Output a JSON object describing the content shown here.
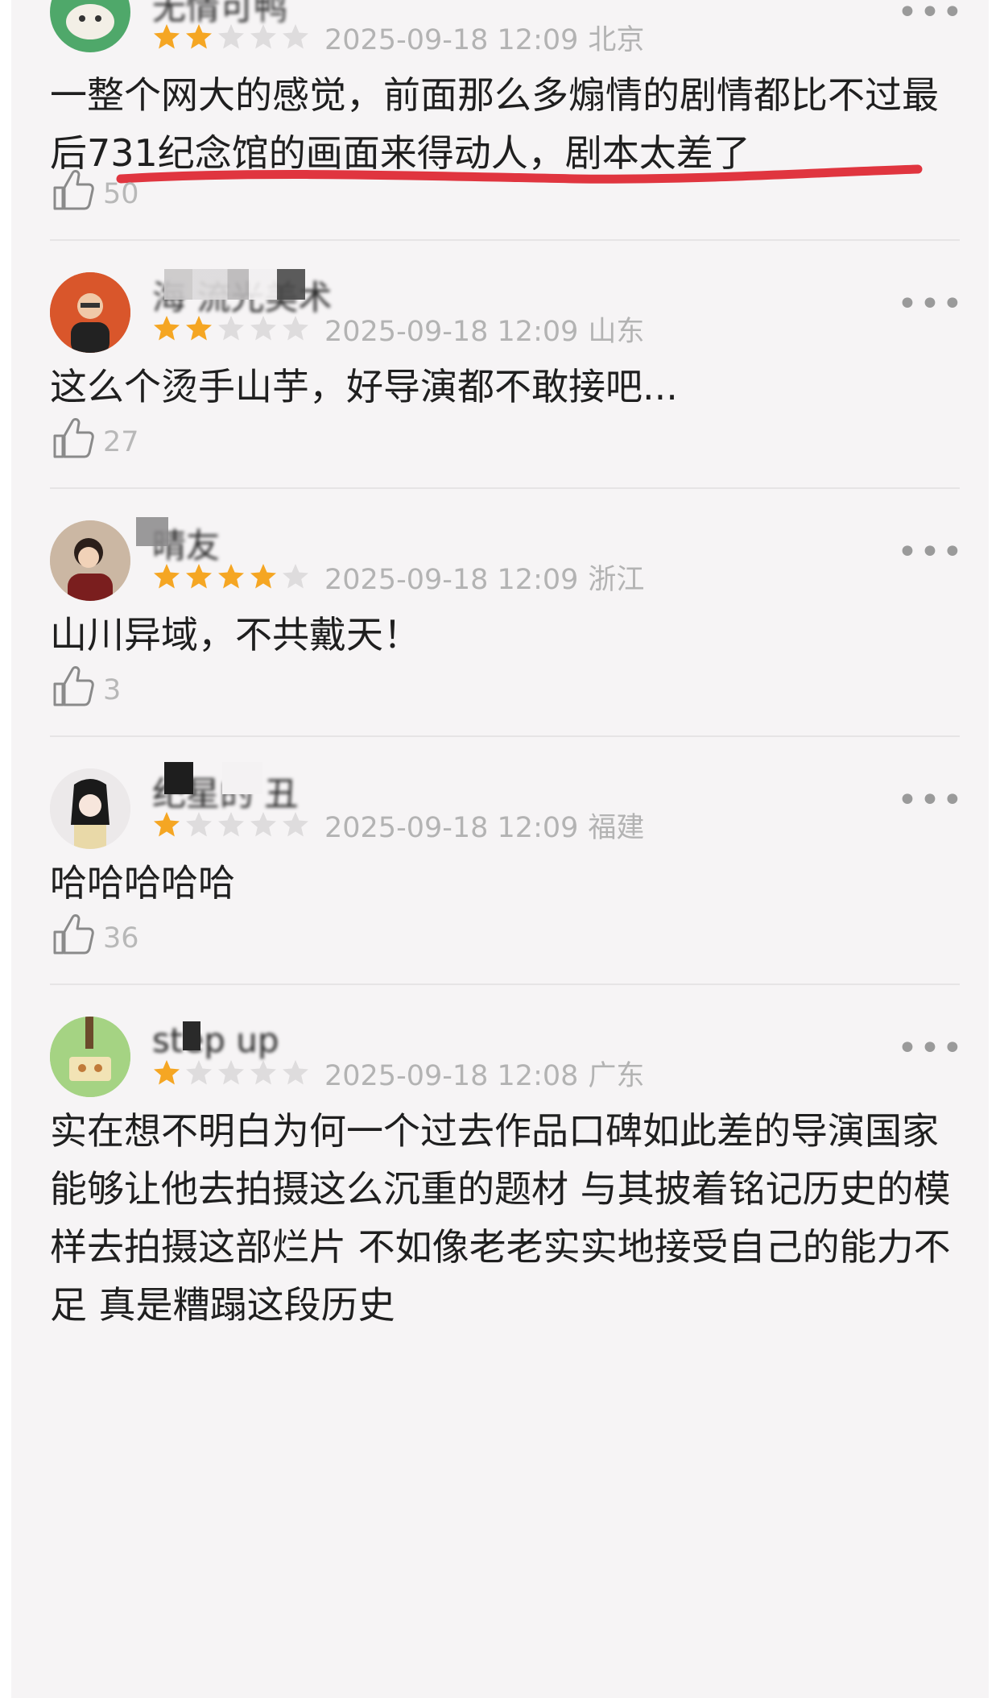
{
  "comments": [
    {
      "username": "无情可鸭",
      "rating": 2,
      "date": "2025-09-18 12:09",
      "region": "北京",
      "text": "一整个网大的感觉，前面那么多煽情的剧情都比不过最后731纪念馆的画面来得动人，剧本太差了",
      "likes": "50"
    },
    {
      "username": "海 流光美术",
      "rating": 2,
      "date": "2025-09-18 12:09",
      "region": "山东",
      "text": "这么个烫手山芋，好导演都不敢接吧...",
      "likes": "27"
    },
    {
      "username": "晴友",
      "rating": 4,
      "date": "2025-09-18 12:09",
      "region": "浙江",
      "text": "山川异域，不共戴天！",
      "likes": "3"
    },
    {
      "username": "纪星的 丑",
      "rating": 1,
      "date": "2025-09-18 12:09",
      "region": "福建",
      "text": "哈哈哈哈哈",
      "likes": "36"
    },
    {
      "username": "step up",
      "rating": 1,
      "date": "2025-09-18 12:08",
      "region": "广东",
      "text": "实在想不明白为何一个过去作品口碑如此差的导演国家能够让他去拍摄这么沉重的题材 与其披着铭记历史的模样去拍摄这部烂片 不如像老老实实地接受自己的能力不足 真是糟蹋这段历史",
      "likes": ""
    }
  ],
  "more_icon": "more-dots-icon",
  "like_icon": "thumbs-up-icon",
  "colors": {
    "star_on": "#f5a623",
    "star_off": "#dedcdd",
    "annotation": "#e0353f"
  }
}
